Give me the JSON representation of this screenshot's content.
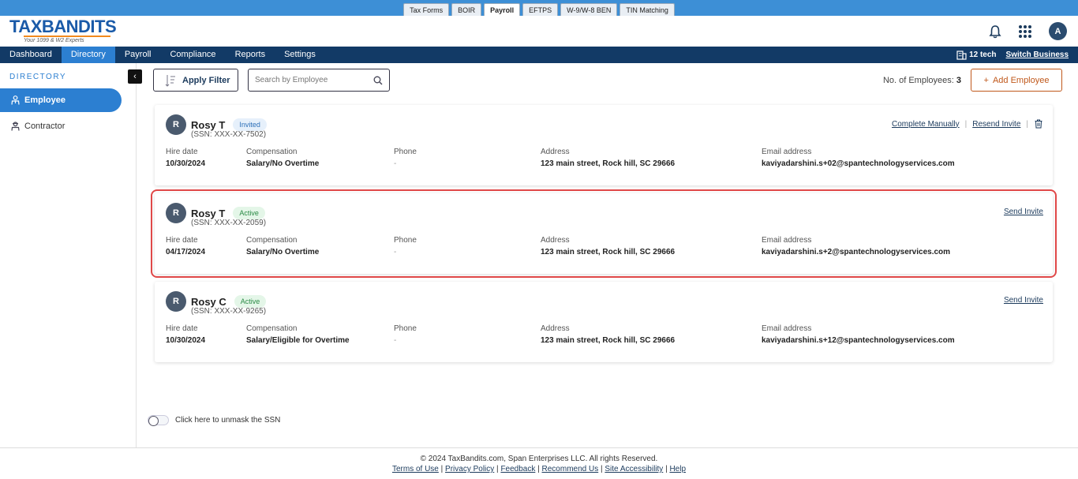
{
  "product_tabs": [
    "Tax Forms",
    "BOIR",
    "Payroll",
    "EFTPS",
    "W-9/W-8 BEN",
    "TIN Matching"
  ],
  "product_tab_active": "Payroll",
  "logo": {
    "brand": "TAXBANDITS",
    "tagline": "Your 1099 & W2 Experts"
  },
  "header": {
    "avatar_initial": "A"
  },
  "nav": {
    "items": [
      "Dashboard",
      "Directory",
      "Payroll",
      "Compliance",
      "Reports",
      "Settings"
    ],
    "active": "Directory",
    "business_name": "12 tech",
    "switch_business": "Switch Business"
  },
  "sidebar": {
    "title": "DIRECTORY",
    "items": [
      "Employee",
      "Contractor"
    ],
    "active": "Employee",
    "collapse_glyph": "‹"
  },
  "toolbar": {
    "apply_filter": "Apply Filter",
    "search_placeholder": "Search by Employee",
    "count_label": "No. of Employees:",
    "count_value": "3",
    "add_employee": "Add Employee"
  },
  "field_labels": {
    "hire_date": "Hire date",
    "compensation": "Compensation",
    "phone": "Phone",
    "address": "Address",
    "email": "Email address"
  },
  "employees": [
    {
      "initial": "R",
      "name": "Rosy T",
      "status": "Invited",
      "ssn": "(SSN: XXX-XX-7502)",
      "hire_date": "10/30/2024",
      "compensation": "Salary/No Overtime",
      "phone": "-",
      "address": "123 main street, Rock hill, SC 29666",
      "email": "kaviyadarshini.s+02@spantechnologyservices.com",
      "action_1": "Complete Manually",
      "action_2": "Resend Invite"
    },
    {
      "initial": "R",
      "name": "Rosy T",
      "status": "Active",
      "ssn": "(SSN: XXX-XX-2059)",
      "hire_date": "04/17/2024",
      "compensation": "Salary/No Overtime",
      "phone": "-",
      "address": "123 main street, Rock hill, SC 29666",
      "email": "kaviyadarshini.s+2@spantechnologyservices.com",
      "action_1": "Send Invite"
    },
    {
      "initial": "R",
      "name": "Rosy C",
      "status": "Active",
      "ssn": "(SSN: XXX-XX-9265)",
      "hire_date": "10/30/2024",
      "compensation": "Salary/Eligible for Overtime",
      "phone": "-",
      "address": "123 main street, Rock hill, SC 29666",
      "email": "kaviyadarshini.s+12@spantechnologyservices.com",
      "action_1": "Send Invite"
    }
  ],
  "unmask_label": "Click here to unmask the SSN",
  "footer": {
    "copyright": "© 2024 TaxBandits.com, Span Enterprises LLC. All rights Reserved.",
    "links": [
      "Terms of Use",
      "Privacy Policy",
      "Feedback",
      "Recommend Us",
      "Site Accessibility",
      "Help"
    ]
  },
  "colors": {
    "nav_bg": "#123a66",
    "accent": "#2c7fd1",
    "add_button": "#c0581b",
    "highlight": "#e04848"
  }
}
